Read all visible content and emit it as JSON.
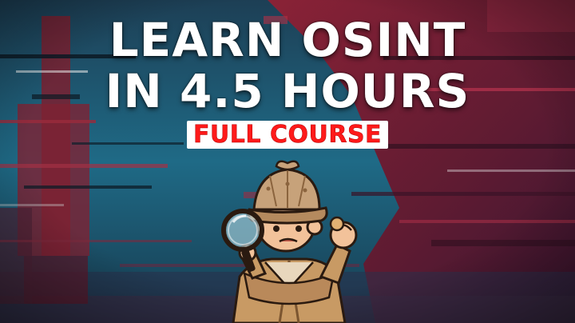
{
  "thumbnail": {
    "title_line_1": "LEARN OSINT",
    "title_line_2": "IN 4.5 HOURS",
    "subtitle": "FULL COURSE",
    "mascot_icon": "detective-with-magnifying-glass-icon",
    "colors": {
      "title": "#ffffff",
      "subtitle": "#ff1a1a",
      "background_teal": "#1f5a73",
      "background_red": "#7a1f33",
      "mascot_coat": "#c89a64",
      "mascot_hat": "#c7a27a"
    }
  }
}
